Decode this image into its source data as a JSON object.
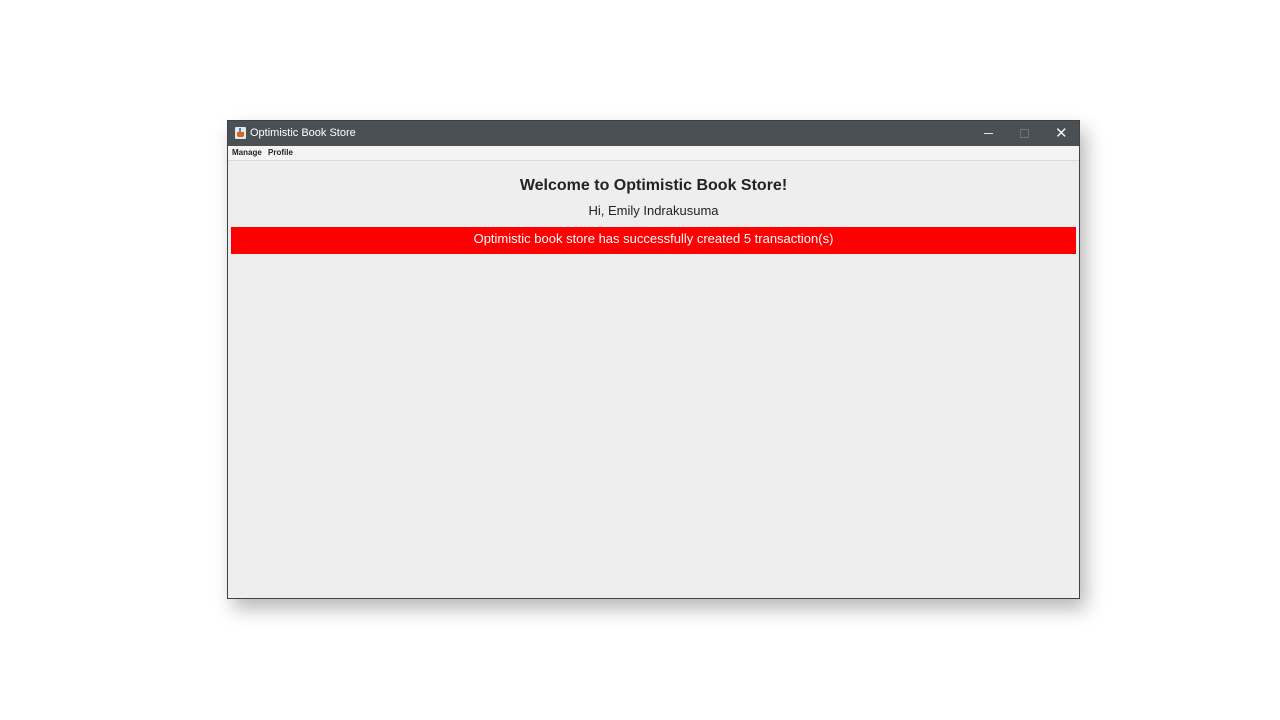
{
  "window": {
    "title": "Optimistic Book Store",
    "minimize_label": "—",
    "close_label": "✕"
  },
  "menubar": {
    "items": [
      "Manage",
      "Profile"
    ]
  },
  "main": {
    "welcome": "Welcome to Optimistic Book Store!",
    "greeting": "Hi, Emily Indrakusuma",
    "banner": "Optimistic book store has successfully created 5 transaction(s)"
  },
  "colors": {
    "titlebar": "#4b5055",
    "banner": "#ff0000",
    "background": "#eeeeee"
  }
}
